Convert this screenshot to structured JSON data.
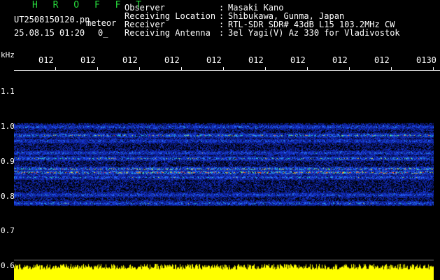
{
  "header": {
    "title": "H R O F F T",
    "file_name": "UT2508150120.pn",
    "event_type": "meteor",
    "timestamp": "25.08.15 01:20",
    "count": "0_",
    "info": [
      {
        "label": "Observer",
        "value": "Masaki Kano"
      },
      {
        "label": "Receiving Location",
        "value": "Shibukawa, Gunma, Japan"
      },
      {
        "label": "Receiver",
        "value": "RTL-SDR SDR# 43dB L15 103.2MHz CW"
      },
      {
        "label": "Receiving Antenna",
        "value": "3el Yagi(V) Az 330 for Vladivostok"
      }
    ]
  },
  "chart_data": {
    "type": "heatmap",
    "ylabel": "kHz",
    "x_tick_labels": [
      "012",
      "012",
      "012",
      "012",
      "012",
      "012",
      "012",
      "012",
      "012",
      "0130"
    ],
    "y_tick_labels": [
      "1.1",
      "1.0",
      "0.9",
      "0.8",
      "0.7",
      "0.6"
    ],
    "ylim": [
      0.6,
      1.15
    ],
    "bands": [
      {
        "freq": 1.0,
        "intensity": 0.55
      },
      {
        "freq": 0.975,
        "intensity": 0.75
      },
      {
        "freq": 0.96,
        "intensity": 0.5
      },
      {
        "freq": 0.925,
        "intensity": 0.55
      },
      {
        "freq": 0.91,
        "intensity": 0.7
      },
      {
        "freq": 0.88,
        "intensity": 0.85
      },
      {
        "freq": 0.87,
        "intensity": 0.95
      },
      {
        "freq": 0.855,
        "intensity": 0.6
      },
      {
        "freq": 0.805,
        "intensity": 0.55
      },
      {
        "freq": 0.78,
        "intensity": 0.6
      }
    ],
    "colors": {
      "background": "#000000",
      "noise": "#0a1a8c",
      "mid": "#2f6cff",
      "high": "#2fe0c8",
      "peak": "#ff3a1a",
      "amplitude": "#ffff00"
    }
  }
}
